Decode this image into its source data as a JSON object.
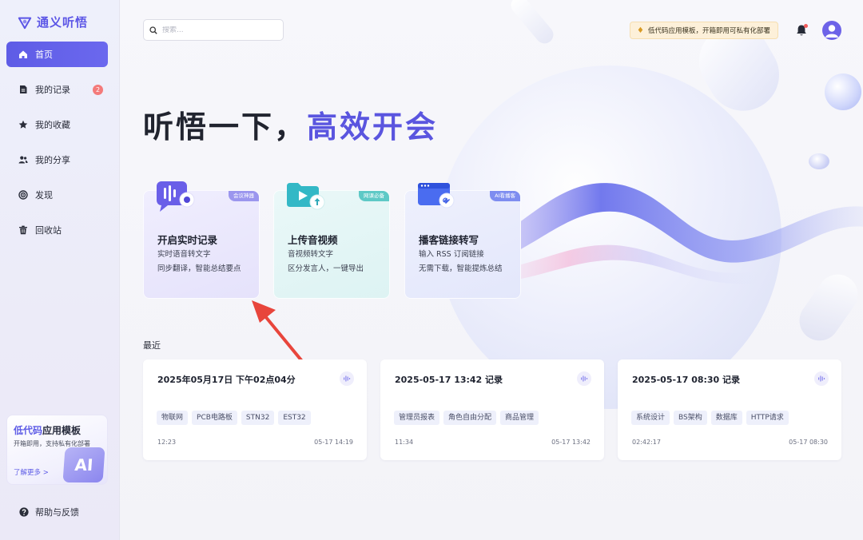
{
  "app": {
    "title": "通义听悟"
  },
  "sidebar": {
    "items": [
      {
        "label": "首页",
        "icon": "home-icon",
        "active": true
      },
      {
        "label": "我的记录",
        "icon": "document-icon",
        "badge": "2"
      },
      {
        "label": "我的收藏",
        "icon": "star-icon"
      },
      {
        "label": "我的分享",
        "icon": "share-users-icon"
      },
      {
        "label": "发现",
        "icon": "discover-icon"
      },
      {
        "label": "回收站",
        "icon": "trash-icon"
      }
    ],
    "promo": {
      "title_highlight": "低代码",
      "title_rest": "应用模板",
      "subtitle": "开箱即用，支持私有化部署",
      "link": "了解更多 >",
      "badge": "AI"
    },
    "help": "帮助与反馈"
  },
  "header": {
    "search_placeholder": "搜索...",
    "notice": "低代码应用模板，开箱即用可私有化部署"
  },
  "hero": {
    "title_prefix": "听悟一下，",
    "title_accent": "高效开会"
  },
  "features": [
    {
      "tag": "会议神器",
      "title": "开启实时记录",
      "line1": "实时语音转文字",
      "line2": "同步翻译，智能总结要点"
    },
    {
      "tag": "网课必备",
      "title": "上传音视频",
      "line1": "音视频转文字",
      "line2": "区分发言人，一键导出"
    },
    {
      "tag": "AI看播客",
      "title": "播客链接转写",
      "line1": "输入 RSS 订阅链接",
      "line2": "无需下载，智能提炼总结"
    }
  ],
  "recent": {
    "title": "最近",
    "cards": [
      {
        "title": "2025年05月17日 下午02点04分",
        "tags": [
          "物联网",
          "PCB电路板",
          "STN32",
          "EST32"
        ],
        "duration": "12:23",
        "date": "05-17 14:19"
      },
      {
        "title": "2025-05-17 13:42 记录",
        "tags": [
          "管理员报表",
          "角色自由分配",
          "商品管理"
        ],
        "duration": "11:34",
        "date": "05-17 13:42"
      },
      {
        "title": "2025-05-17 08:30 记录",
        "tags": [
          "系统设计",
          "BS架构",
          "数据库",
          "HTTP请求"
        ],
        "duration": "02:42:17",
        "date": "05-17 08:30"
      }
    ]
  },
  "colors": {
    "accent": "#5e5ce6",
    "annotation_arrow": "#e8453c",
    "badge": "#f47a7a"
  }
}
